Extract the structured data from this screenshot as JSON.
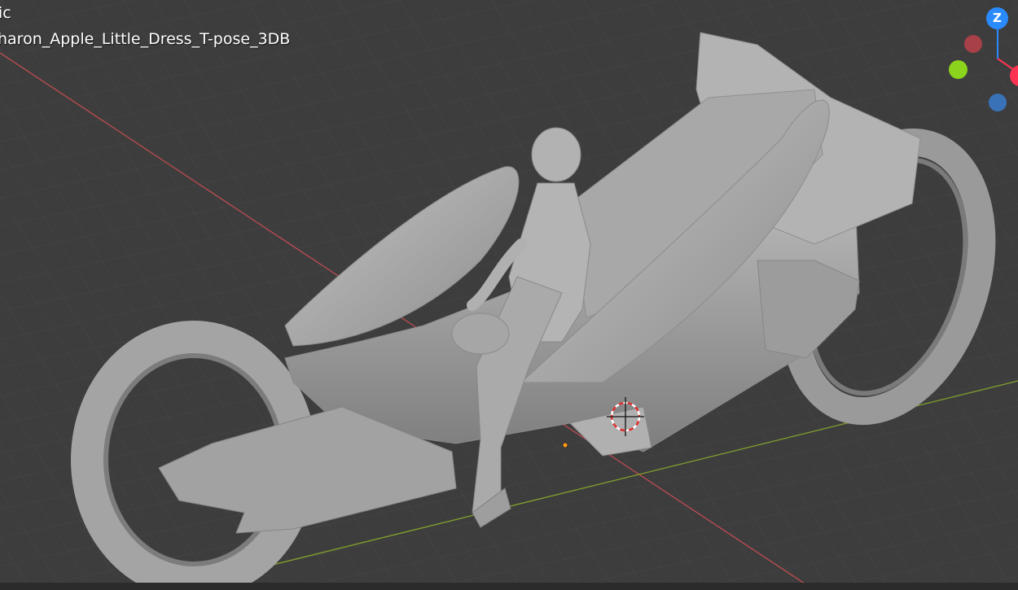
{
  "viewport": {
    "view_mode_label": "ic",
    "object_name": "haron_Apple_Little_Dress_T-pose_3DB",
    "background_color": "#3d3d3d",
    "grid_color": "#474747",
    "x_axis_color": "#b64b4f",
    "y_axis_color": "#7f9b2e",
    "model_color": "#a9a9a9"
  },
  "gizmo": {
    "z_label": "Z",
    "colors": {
      "z": "#2a8bff",
      "x": "#ff3352",
      "x_neg": "#a84048",
      "y": "#8bd31c",
      "y_neg": "#3a72b8"
    }
  },
  "icons": {
    "cursor": "3d-cursor-icon",
    "origin": "object-origin-icon"
  }
}
